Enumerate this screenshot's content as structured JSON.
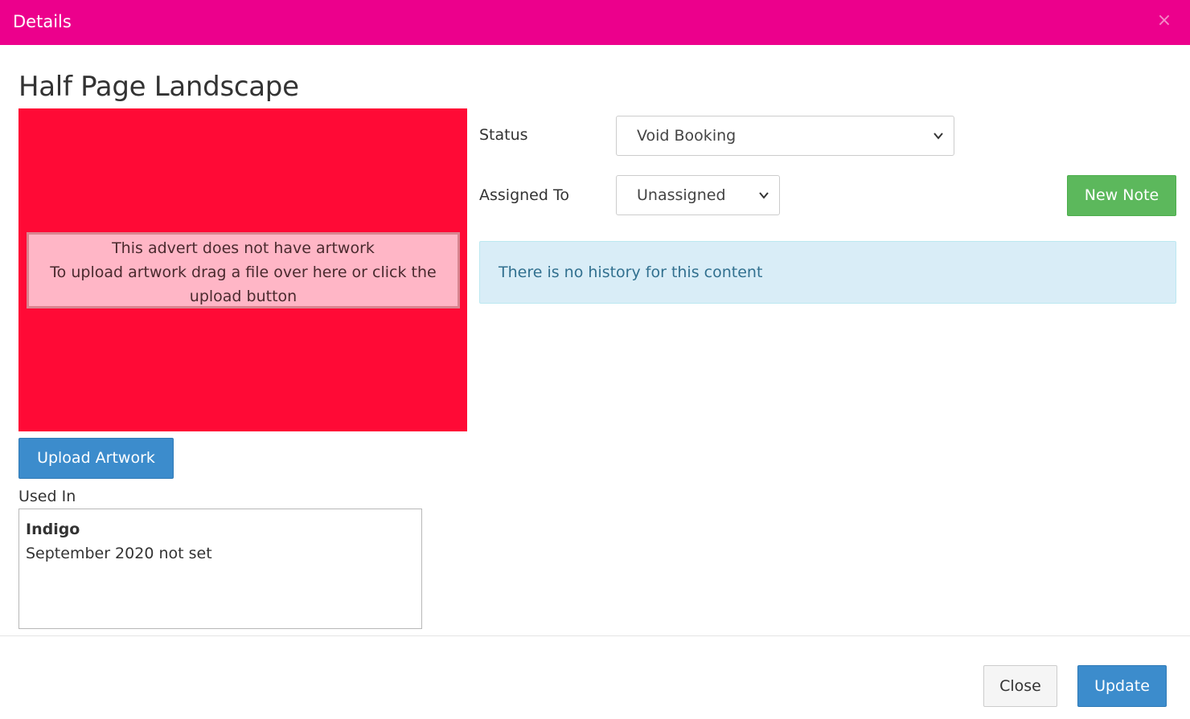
{
  "modal": {
    "title": "Details",
    "close_icon": "×"
  },
  "content": {
    "title": "Half Page Landscape"
  },
  "artwork": {
    "background_color": "#ff0a36",
    "message_line1": "This advert does not have artwork",
    "message_line2": "To upload artwork drag a file over here or click the upload button",
    "upload_label": "Upload Artwork"
  },
  "used_in": {
    "label": "Used In",
    "items": [
      {
        "name": "Indigo",
        "detail": "September 2020 not set"
      }
    ]
  },
  "status": {
    "label": "Status",
    "selected": "Void Booking"
  },
  "assigned_to": {
    "label": "Assigned To",
    "selected": "Unassigned"
  },
  "new_note_label": "New Note",
  "history": {
    "message": "There is no history for this content"
  },
  "footer": {
    "close_label": "Close",
    "update_label": "Update"
  },
  "colors": {
    "header": "#ec008c",
    "primary": "#3c8ccc",
    "success": "#5cb85c",
    "info_bg": "#d9edf7",
    "info_text": "#31708f"
  }
}
